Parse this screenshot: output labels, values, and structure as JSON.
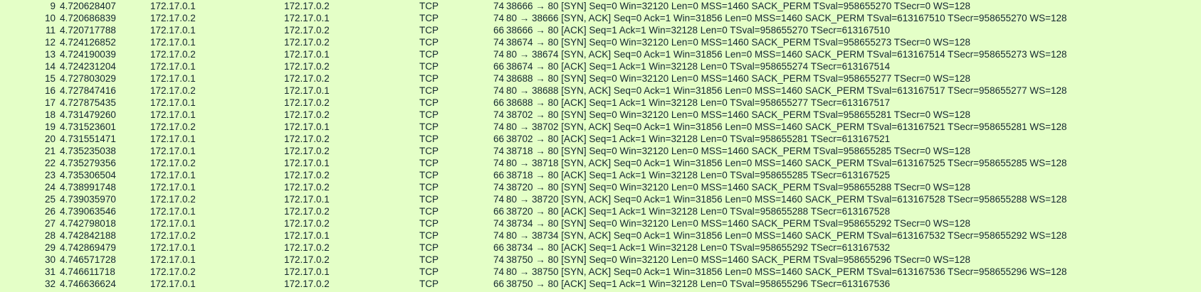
{
  "colors": {
    "row_background": "#e4ffc7",
    "text": "#12272e"
  },
  "packets": [
    {
      "no": "9",
      "time": "4.720628407",
      "source": "172.17.0.1",
      "destination": "172.17.0.2",
      "protocol": "TCP",
      "length": "74",
      "info": "38666 → 80 [SYN] Seq=0 Win=32120 Len=0 MSS=1460 SACK_PERM TSval=958655270 TSecr=0 WS=128"
    },
    {
      "no": "10",
      "time": "4.720686839",
      "source": "172.17.0.2",
      "destination": "172.17.0.1",
      "protocol": "TCP",
      "length": "74",
      "info": "80 → 38666 [SYN, ACK] Seq=0 Ack=1 Win=31856 Len=0 MSS=1460 SACK_PERM TSval=613167510 TSecr=958655270 WS=128"
    },
    {
      "no": "11",
      "time": "4.720717788",
      "source": "172.17.0.1",
      "destination": "172.17.0.2",
      "protocol": "TCP",
      "length": "66",
      "info": "38666 → 80 [ACK] Seq=1 Ack=1 Win=32128 Len=0 TSval=958655270 TSecr=613167510"
    },
    {
      "no": "12",
      "time": "4.724126852",
      "source": "172.17.0.1",
      "destination": "172.17.0.2",
      "protocol": "TCP",
      "length": "74",
      "info": "38674 → 80 [SYN] Seq=0 Win=32120 Len=0 MSS=1460 SACK_PERM TSval=958655273 TSecr=0 WS=128"
    },
    {
      "no": "13",
      "time": "4.724190039",
      "source": "172.17.0.2",
      "destination": "172.17.0.1",
      "protocol": "TCP",
      "length": "74",
      "info": "80 → 38674 [SYN, ACK] Seq=0 Ack=1 Win=31856 Len=0 MSS=1460 SACK_PERM TSval=613167514 TSecr=958655273 WS=128"
    },
    {
      "no": "14",
      "time": "4.724231204",
      "source": "172.17.0.1",
      "destination": "172.17.0.2",
      "protocol": "TCP",
      "length": "66",
      "info": "38674 → 80 [ACK] Seq=1 Ack=1 Win=32128 Len=0 TSval=958655274 TSecr=613167514"
    },
    {
      "no": "15",
      "time": "4.727803029",
      "source": "172.17.0.1",
      "destination": "172.17.0.2",
      "protocol": "TCP",
      "length": "74",
      "info": "38688 → 80 [SYN] Seq=0 Win=32120 Len=0 MSS=1460 SACK_PERM TSval=958655277 TSecr=0 WS=128"
    },
    {
      "no": "16",
      "time": "4.727847416",
      "source": "172.17.0.2",
      "destination": "172.17.0.1",
      "protocol": "TCP",
      "length": "74",
      "info": "80 → 38688 [SYN, ACK] Seq=0 Ack=1 Win=31856 Len=0 MSS=1460 SACK_PERM TSval=613167517 TSecr=958655277 WS=128"
    },
    {
      "no": "17",
      "time": "4.727875435",
      "source": "172.17.0.1",
      "destination": "172.17.0.2",
      "protocol": "TCP",
      "length": "66",
      "info": "38688 → 80 [ACK] Seq=1 Ack=1 Win=32128 Len=0 TSval=958655277 TSecr=613167517"
    },
    {
      "no": "18",
      "time": "4.731479260",
      "source": "172.17.0.1",
      "destination": "172.17.0.2",
      "protocol": "TCP",
      "length": "74",
      "info": "38702 → 80 [SYN] Seq=0 Win=32120 Len=0 MSS=1460 SACK_PERM TSval=958655281 TSecr=0 WS=128"
    },
    {
      "no": "19",
      "time": "4.731523601",
      "source": "172.17.0.2",
      "destination": "172.17.0.1",
      "protocol": "TCP",
      "length": "74",
      "info": "80 → 38702 [SYN, ACK] Seq=0 Ack=1 Win=31856 Len=0 MSS=1460 SACK_PERM TSval=613167521 TSecr=958655281 WS=128"
    },
    {
      "no": "20",
      "time": "4.731551471",
      "source": "172.17.0.1",
      "destination": "172.17.0.2",
      "protocol": "TCP",
      "length": "66",
      "info": "38702 → 80 [ACK] Seq=1 Ack=1 Win=32128 Len=0 TSval=958655281 TSecr=613167521"
    },
    {
      "no": "21",
      "time": "4.735235038",
      "source": "172.17.0.1",
      "destination": "172.17.0.2",
      "protocol": "TCP",
      "length": "74",
      "info": "38718 → 80 [SYN] Seq=0 Win=32120 Len=0 MSS=1460 SACK_PERM TSval=958655285 TSecr=0 WS=128"
    },
    {
      "no": "22",
      "time": "4.735279356",
      "source": "172.17.0.2",
      "destination": "172.17.0.1",
      "protocol": "TCP",
      "length": "74",
      "info": "80 → 38718 [SYN, ACK] Seq=0 Ack=1 Win=31856 Len=0 MSS=1460 SACK_PERM TSval=613167525 TSecr=958655285 WS=128"
    },
    {
      "no": "23",
      "time": "4.735306504",
      "source": "172.17.0.1",
      "destination": "172.17.0.2",
      "protocol": "TCP",
      "length": "66",
      "info": "38718 → 80 [ACK] Seq=1 Ack=1 Win=32128 Len=0 TSval=958655285 TSecr=613167525"
    },
    {
      "no": "24",
      "time": "4.738991748",
      "source": "172.17.0.1",
      "destination": "172.17.0.2",
      "protocol": "TCP",
      "length": "74",
      "info": "38720 → 80 [SYN] Seq=0 Win=32120 Len=0 MSS=1460 SACK_PERM TSval=958655288 TSecr=0 WS=128"
    },
    {
      "no": "25",
      "time": "4.739035970",
      "source": "172.17.0.2",
      "destination": "172.17.0.1",
      "protocol": "TCP",
      "length": "74",
      "info": "80 → 38720 [SYN, ACK] Seq=0 Ack=1 Win=31856 Len=0 MSS=1460 SACK_PERM TSval=613167528 TSecr=958655288 WS=128"
    },
    {
      "no": "26",
      "time": "4.739063546",
      "source": "172.17.0.1",
      "destination": "172.17.0.2",
      "protocol": "TCP",
      "length": "66",
      "info": "38720 → 80 [ACK] Seq=1 Ack=1 Win=32128 Len=0 TSval=958655288 TSecr=613167528"
    },
    {
      "no": "27",
      "time": "4.742798018",
      "source": "172.17.0.1",
      "destination": "172.17.0.2",
      "protocol": "TCP",
      "length": "74",
      "info": "38734 → 80 [SYN] Seq=0 Win=32120 Len=0 MSS=1460 SACK_PERM TSval=958655292 TSecr=0 WS=128"
    },
    {
      "no": "28",
      "time": "4.742842188",
      "source": "172.17.0.2",
      "destination": "172.17.0.1",
      "protocol": "TCP",
      "length": "74",
      "info": "80 → 38734 [SYN, ACK] Seq=0 Ack=1 Win=31856 Len=0 MSS=1460 SACK_PERM TSval=613167532 TSecr=958655292 WS=128"
    },
    {
      "no": "29",
      "time": "4.742869479",
      "source": "172.17.0.1",
      "destination": "172.17.0.2",
      "protocol": "TCP",
      "length": "66",
      "info": "38734 → 80 [ACK] Seq=1 Ack=1 Win=32128 Len=0 TSval=958655292 TSecr=613167532"
    },
    {
      "no": "30",
      "time": "4.746571728",
      "source": "172.17.0.1",
      "destination": "172.17.0.2",
      "protocol": "TCP",
      "length": "74",
      "info": "38750 → 80 [SYN] Seq=0 Win=32120 Len=0 MSS=1460 SACK_PERM TSval=958655296 TSecr=0 WS=128"
    },
    {
      "no": "31",
      "time": "4.746611718",
      "source": "172.17.0.2",
      "destination": "172.17.0.1",
      "protocol": "TCP",
      "length": "74",
      "info": "80 → 38750 [SYN, ACK] Seq=0 Ack=1 Win=31856 Len=0 MSS=1460 SACK_PERM TSval=613167536 TSecr=958655296 WS=128"
    },
    {
      "no": "32",
      "time": "4.746636624",
      "source": "172.17.0.1",
      "destination": "172.17.0.2",
      "protocol": "TCP",
      "length": "66",
      "info": "38750 → 80 [ACK] Seq=1 Ack=1 Win=32128 Len=0 TSval=958655296 TSecr=613167536"
    }
  ]
}
